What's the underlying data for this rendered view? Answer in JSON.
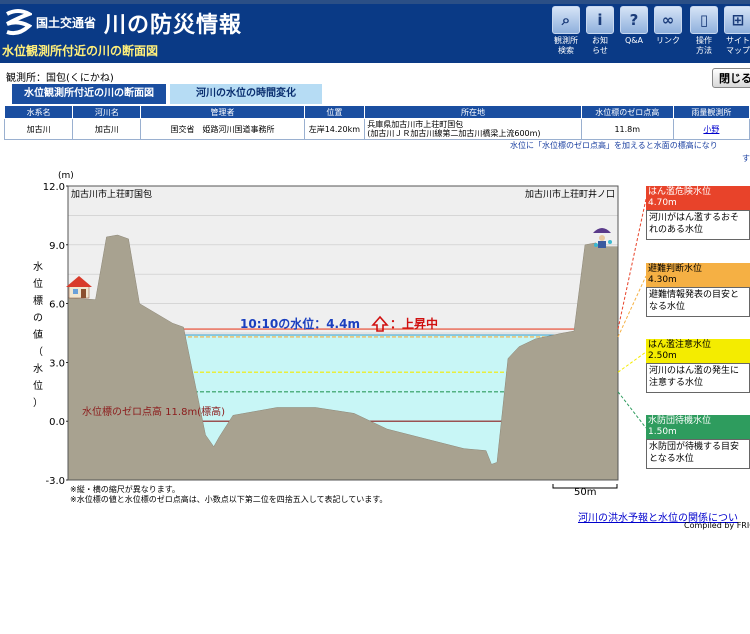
{
  "header": {
    "ministry": "国土交通省",
    "site_title": "川の防災情報",
    "page_subtitle": "水位観測所付近の川の断面図",
    "nav": [
      {
        "icon": "search-icon",
        "label1": "観測所",
        "label2": "検索"
      },
      {
        "icon": "info-icon",
        "label1": "お知",
        "label2": "らせ"
      },
      {
        "icon": "question-icon",
        "label1": "Q&A",
        "label2": ""
      },
      {
        "icon": "link-icon",
        "label1": "リンク",
        "label2": ""
      },
      {
        "icon": "mouse-icon",
        "label1": "操作",
        "label2": "方法"
      },
      {
        "icon": "sitemap-icon",
        "label1": "サイト",
        "label2": "マップ"
      }
    ]
  },
  "station": "観測所：国包(くにかね)",
  "close_label": "閉じる",
  "tabs": {
    "section": "水位観測所付近の川の断面図",
    "time": "河川の水位の時間変化"
  },
  "table": {
    "headers": [
      "水系名",
      "河川名",
      "管理者",
      "位置",
      "所在地",
      "水位標のゼロ点高",
      "雨量観測所"
    ],
    "row": {
      "system": "加古川",
      "river": "加古川",
      "manager": "国交省　姫路河川国道事務所",
      "position": "左岸14.20km",
      "address1": "兵庫県加古川市上荘町国包",
      "address2": "(加古川ＪＲ加古川線第二加古川橋梁上流600m)",
      "zero_height": "11.8m",
      "rain_station": "小野"
    }
  },
  "note": "水位に「水位標のゼロ点高」を加えると水面の標高になり",
  "note2": "す",
  "chart_data": {
    "type": "area",
    "yunit": "(m)",
    "ylabel": "水位標の値（水位）",
    "yticks": [
      "12.0",
      "9.0",
      "6.0",
      "3.0",
      "0.0",
      "-3.0"
    ],
    "ylim": [
      -3.0,
      12.0
    ],
    "left_bank": "加古川市上荘町国包",
    "right_bank": "加古川市上荘町井ノ口",
    "current_label": "10:10の水位：4.4m",
    "trend_label": "上昇中",
    "current_level": 4.4,
    "zero_label": "水位標のゼロ点高 11.8m(標高)",
    "levels": [
      {
        "name": "はん濫危険水位",
        "value_label": "4.70m",
        "value": 4.7,
        "color": "#e8432a",
        "text_color": "#ffffff",
        "desc1": "河川がはん濫するおそ",
        "desc2": "れのある水位"
      },
      {
        "name": "避難判断水位",
        "value_label": "4.30m",
        "value": 4.3,
        "color": "#f5b044",
        "text_color": "#000000",
        "desc1": "避難情報発表の目安と",
        "desc2": "なる水位"
      },
      {
        "name": "はん濫注意水位",
        "value_label": "2.50m",
        "value": 2.5,
        "color": "#f4ec00",
        "text_color": "#000000",
        "desc1": "河川のはん濫の発生に",
        "desc2": "注意する水位"
      },
      {
        "name": "水防団待機水位",
        "value_label": "1.50m",
        "value": 1.5,
        "color": "#2e9c5e",
        "text_color": "#ffffff",
        "desc1": "水防団が待機する目安",
        "desc2": "となる水位"
      }
    ],
    "scale_label": "50m",
    "profile": [
      [
        0,
        6.3
      ],
      [
        0.05,
        6.2
      ],
      [
        0.07,
        9.4
      ],
      [
        0.09,
        9.5
      ],
      [
        0.11,
        9.3
      ],
      [
        0.13,
        6.0
      ],
      [
        0.19,
        5.0
      ],
      [
        0.21,
        4.8
      ],
      [
        0.25,
        -0.7
      ],
      [
        0.265,
        -1.3
      ],
      [
        0.275,
        -0.8
      ],
      [
        0.3,
        0.3
      ],
      [
        0.38,
        0.7
      ],
      [
        0.45,
        0.7
      ],
      [
        0.52,
        0.4
      ],
      [
        0.58,
        -0.4
      ],
      [
        0.65,
        -0.9
      ],
      [
        0.72,
        -1.4
      ],
      [
        0.76,
        -1.5
      ],
      [
        0.77,
        -2.2
      ],
      [
        0.78,
        -2.1
      ],
      [
        0.8,
        3.2
      ],
      [
        0.82,
        3.8
      ],
      [
        0.85,
        4.2
      ],
      [
        0.9,
        4.5
      ],
      [
        0.92,
        4.6
      ],
      [
        0.94,
        9.0
      ],
      [
        0.96,
        9.1
      ],
      [
        0.965,
        8.9
      ],
      [
        1.0,
        8.9
      ]
    ]
  },
  "footnote1": "※縦・横の縮尺が異なります。",
  "footnote2": "※水位標の値と水位標のゼロ点高は、小数点以下第二位を四捨五入して表記しています。",
  "flood_link": "河川の洪水予報と水位の関係につい",
  "compiled": "Compiled by FRIC"
}
